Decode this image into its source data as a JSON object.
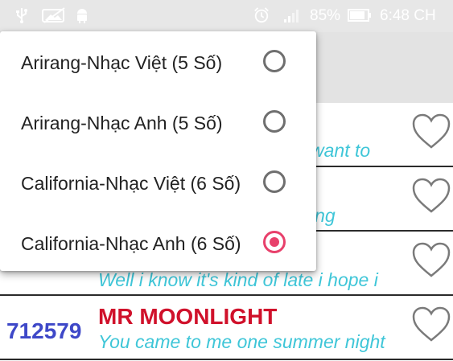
{
  "status_bar": {
    "battery_percent": "85%",
    "time": "6:48 CH",
    "icons": [
      "usb-icon",
      "image-icon",
      "android-icon",
      "alarm-icon",
      "signal-icon",
      "battery-icon"
    ]
  },
  "menu": {
    "items": [
      {
        "label": "Arirang-Nhạc Việt (5 Số)",
        "checked": false
      },
      {
        "label": "Arirang-Nhạc Anh (5 Số)",
        "checked": false
      },
      {
        "label": "California-Nhạc Việt (6 Số)",
        "checked": false
      },
      {
        "label": "California-Nhạc Anh (6 Số)",
        "checked": true
      }
    ]
  },
  "songs": [
    {
      "code": "",
      "title": "",
      "lyric": "want to"
    },
    {
      "code": "",
      "title": "",
      "lyric": "ing"
    },
    {
      "code": "",
      "title": "",
      "lyric": "Well i know it's kind of late i hope i"
    },
    {
      "code": "712579",
      "title": "MR MOONLIGHT",
      "lyric": "You came to me one summer night"
    }
  ],
  "colors": {
    "code": "#3e48c8",
    "title": "#d0112b",
    "lyric": "#3fc6d8",
    "radio_checked": "#e8406b",
    "radio_unchecked": "#6f6f6f"
  }
}
